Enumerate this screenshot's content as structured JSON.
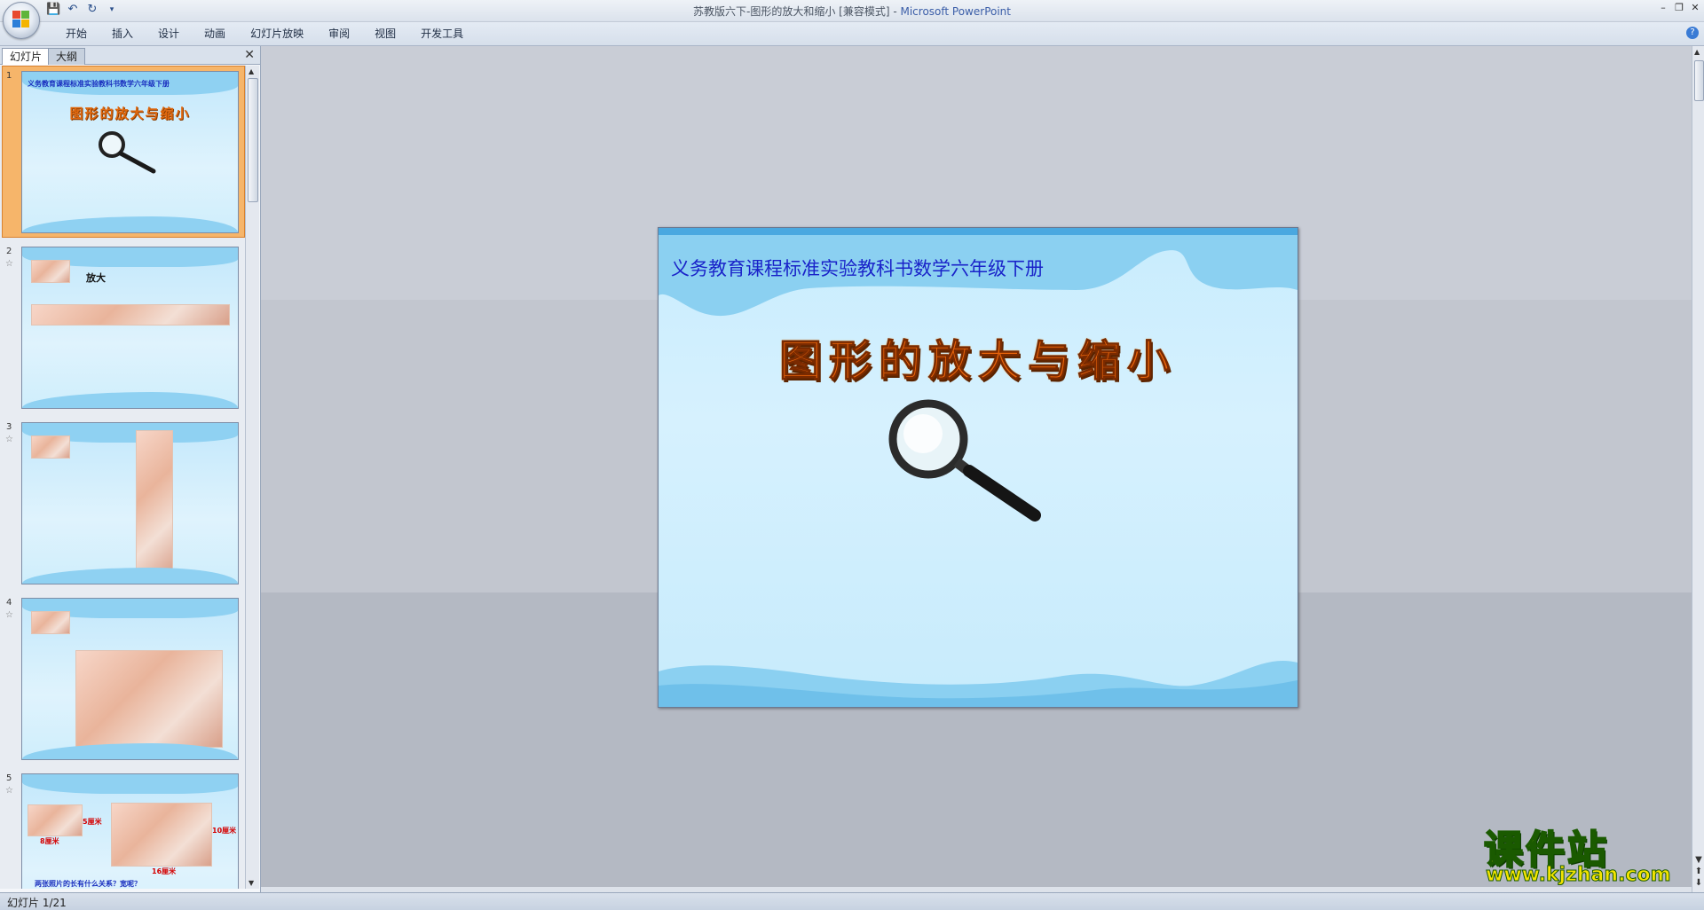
{
  "window": {
    "title": "苏教版六下-图形的放大和缩小 [兼容模式] - ",
    "app_name": "Microsoft PowerPoint"
  },
  "quick_access": {
    "save_icon": "save-icon",
    "undo_icon": "undo-icon",
    "redo_icon": "redo-icon",
    "customize_icon": "customize-qat-icon"
  },
  "ribbon": {
    "tabs": [
      "开始",
      "插入",
      "设计",
      "动画",
      "幻灯片放映",
      "审阅",
      "视图",
      "开发工具"
    ],
    "help": "?"
  },
  "left_panel": {
    "tab_slides": "幻灯片",
    "tab_outline": "大纲",
    "close": "✕",
    "thumbnails": [
      {
        "num": "1",
        "subtitle": "义务教育课程标准实验教科书数学六年级下册",
        "heading": "图形的放大与缩小"
      },
      {
        "num": "2",
        "label": "放大"
      },
      {
        "num": "3"
      },
      {
        "num": "4"
      },
      {
        "num": "5",
        "label_a": "5厘米",
        "label_b": "8厘米",
        "label_c": "10厘米",
        "label_d": "16厘米",
        "question": "两张照片的长有什么关系？宽呢？"
      }
    ]
  },
  "slide": {
    "subtitle": "义务教育课程标准实验教科书数学六年级下册",
    "title": "图形的放大与缩小"
  },
  "status": {
    "slide_indicator": "幻灯片 1/21"
  },
  "watermark": {
    "title": "课件站",
    "url": "www.kjzhan.com"
  },
  "colors": {
    "slide_subtitle": "#1a23c9",
    "slide_title": "#e9650b",
    "selected_thumb": "#f6b56a",
    "watermark_text": "#f4e400"
  }
}
